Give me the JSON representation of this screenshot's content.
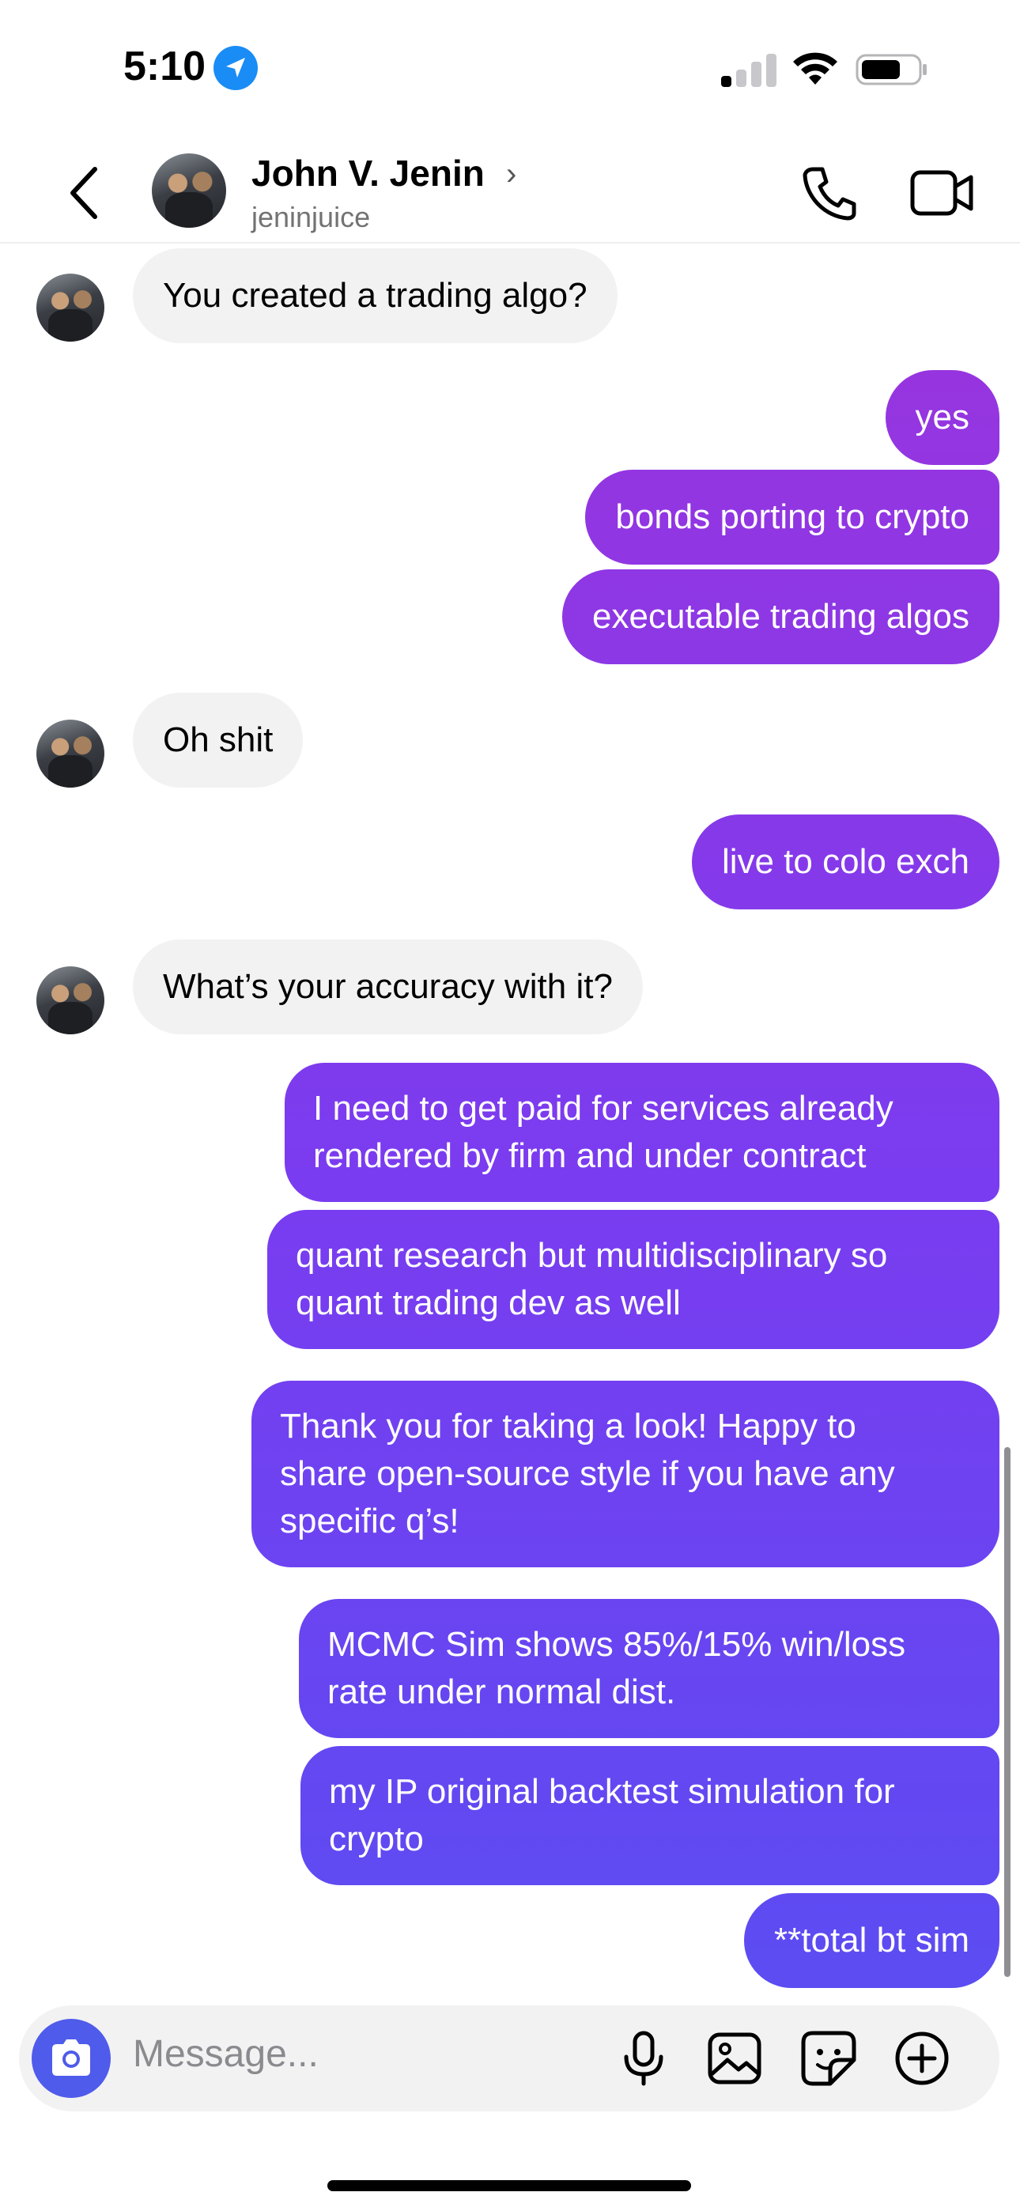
{
  "status_bar": {
    "time": "5:10",
    "location_icon": "location-arrow-icon",
    "signal_icon": "cellular-signal-icon",
    "wifi_icon": "wifi-icon",
    "battery_icon": "battery-icon"
  },
  "header": {
    "back_icon": "chevron-left-icon",
    "name": "John V. Jenin",
    "chevron": "›",
    "username": "jeninjuice",
    "call_icon": "phone-icon",
    "video_icon": "video-camera-icon"
  },
  "messages": [
    {
      "sender": "them",
      "text": "You created a trading algo?"
    },
    {
      "sender": "me",
      "text": "yes"
    },
    {
      "sender": "me",
      "text": "bonds porting to crypto"
    },
    {
      "sender": "me",
      "text": "executable trading algos"
    },
    {
      "sender": "them",
      "text": "Oh shit"
    },
    {
      "sender": "me",
      "text": "live to colo exch"
    },
    {
      "sender": "them",
      "text": "What’s your accuracy with it?"
    },
    {
      "sender": "me",
      "text": "I need to get paid for services already\nrendered by firm and under contract"
    },
    {
      "sender": "me",
      "text": "quant research but multidisciplinary so\nquant trading dev as well"
    },
    {
      "sender": "me",
      "text": "Thank you for taking a look! Happy to\nshare open-source style if you have any\nspecific q’s!"
    },
    {
      "sender": "me",
      "text": "MCMC Sim shows 85%/15% win/loss\nrate under normal dist."
    },
    {
      "sender": "me",
      "text": "my IP original backtest simulation for\ncrypto"
    },
    {
      "sender": "me",
      "text": "**total bt sim"
    }
  ],
  "composer": {
    "camera_icon": "camera-icon",
    "placeholder": "Message...",
    "mic_icon": "microphone-icon",
    "gallery_icon": "image-gallery-icon",
    "sticker_icon": "sticker-icon",
    "add_icon": "plus-circle-icon"
  },
  "colors": {
    "bubble_gradient_top": "#a332d8",
    "bubble_gradient_mid": "#7a3cf0",
    "bubble_gradient_bottom": "#5c4cf2",
    "incoming_bubble": "#f2f2f3",
    "camera_button": "#4f5bea",
    "location_blue": "#1a8cf5"
  }
}
